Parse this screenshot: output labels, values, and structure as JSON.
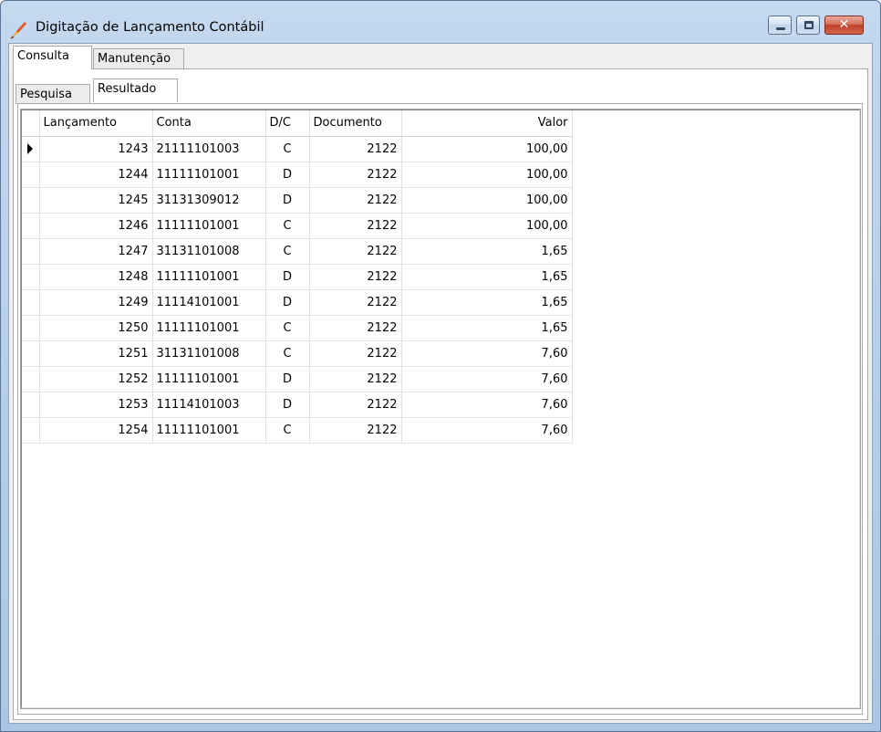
{
  "window": {
    "title": "Digitação de Lançamento Contábil",
    "controls": {
      "minimize": "minimize",
      "maximize": "maximize",
      "close": "✕"
    }
  },
  "outer_tabs": [
    {
      "label": "Consulta",
      "active": true
    },
    {
      "label": "Manutenção",
      "active": false
    }
  ],
  "inner_tabs": [
    {
      "label": "Pesquisa",
      "active": false
    },
    {
      "label": "Resultado",
      "active": true
    }
  ],
  "grid": {
    "columns": [
      "Lançamento",
      "Conta",
      "D/C",
      "Documento",
      "Valor"
    ],
    "rows": [
      {
        "lancamento": "1243",
        "conta": "21111101003",
        "dc": "C",
        "documento": "2122",
        "valor": "100,00",
        "current": true
      },
      {
        "lancamento": "1244",
        "conta": "11111101001",
        "dc": "D",
        "documento": "2122",
        "valor": "100,00"
      },
      {
        "lancamento": "1245",
        "conta": "31131309012",
        "dc": "D",
        "documento": "2122",
        "valor": "100,00"
      },
      {
        "lancamento": "1246",
        "conta": "11111101001",
        "dc": "C",
        "documento": "2122",
        "valor": "100,00"
      },
      {
        "lancamento": "1247",
        "conta": "31131101008",
        "dc": "C",
        "documento": "2122",
        "valor": "1,65"
      },
      {
        "lancamento": "1248",
        "conta": "11111101001",
        "dc": "D",
        "documento": "2122",
        "valor": "1,65"
      },
      {
        "lancamento": "1249",
        "conta": "11114101001",
        "dc": "D",
        "documento": "2122",
        "valor": "1,65"
      },
      {
        "lancamento": "1250",
        "conta": "11111101001",
        "dc": "C",
        "documento": "2122",
        "valor": "1,65"
      },
      {
        "lancamento": "1251",
        "conta": "31131101008",
        "dc": "C",
        "documento": "2122",
        "valor": "7,60"
      },
      {
        "lancamento": "1252",
        "conta": "11111101001",
        "dc": "D",
        "documento": "2122",
        "valor": "7,60"
      },
      {
        "lancamento": "1253",
        "conta": "11114101003",
        "dc": "D",
        "documento": "2122",
        "valor": "7,60"
      },
      {
        "lancamento": "1254",
        "conta": "11111101001",
        "dc": "C",
        "documento": "2122",
        "valor": "7,60"
      }
    ]
  },
  "colors": {
    "title_gradient_top": "#c4d8ee",
    "title_gradient_bottom": "#aac6e4",
    "close_button": "#c1412a",
    "client_background": "#f0f0f0",
    "grid_line": "#e2e2e2"
  },
  "icons": {
    "app": "pen-icon",
    "current_row": "row-indicator-arrow-icon"
  }
}
